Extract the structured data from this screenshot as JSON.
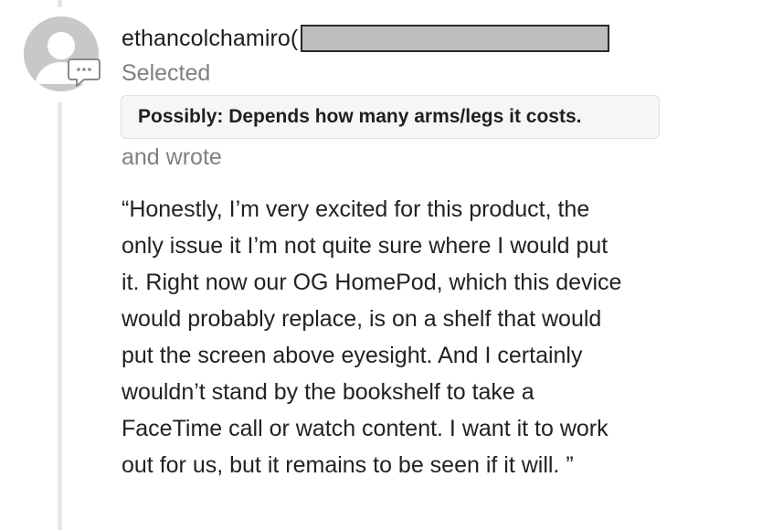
{
  "comment": {
    "username": "ethancolchamiro(",
    "action_label": "Selected",
    "selected_option": "Possibly: Depends how many arms/legs it costs.",
    "wrote_label": "and wrote",
    "body_lines": [
      "“Honestly, I’m very excited for this product, the",
      "only issue it I’m not quite sure where I would put",
      "it. Right now our OG HomePod, which this device",
      "would probably replace, is on a shelf that would",
      "put the screen above eyesight. And I certainly",
      "wouldn’t stand by the bookshelf to take a",
      "FaceTime call or watch content. I want it to work",
      "out for us, but it remains to be seen if it will. ”"
    ]
  },
  "icons": {
    "avatar": "default-user-avatar",
    "badge": "comment-bubble-icon"
  },
  "colors": {
    "avatar_gray": "#c8c8c8",
    "secondary_text": "#808080",
    "thread_line": "#e6e6e6",
    "redaction": "#bdbdbd"
  }
}
